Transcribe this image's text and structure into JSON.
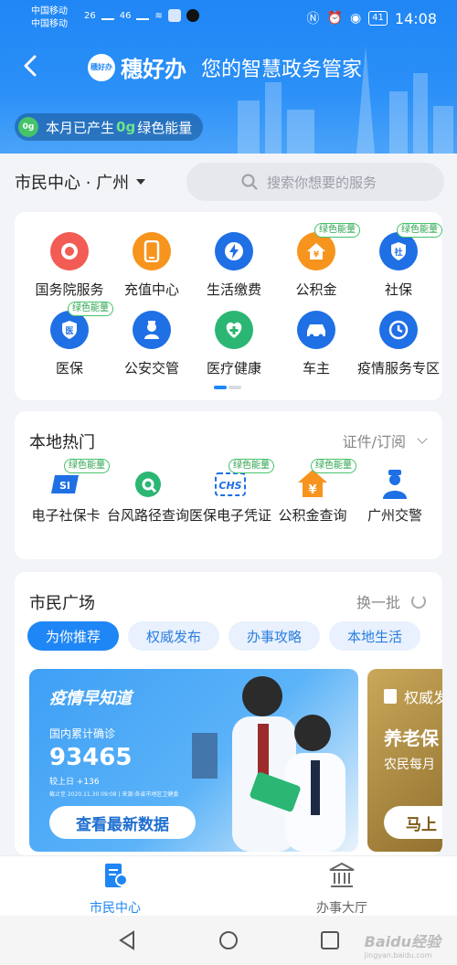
{
  "status_bar": {
    "carrier1": "中国移动",
    "carrier2": "中国移动",
    "signal1": "26",
    "signal2": "46",
    "battery": "41",
    "time": "14:08"
  },
  "header": {
    "logo_text": "穗好办",
    "app_name": "穗好办",
    "slogan": "您的智慧政务管家",
    "energy_badge": "0g",
    "energy_prefix": "本月已产生",
    "energy_value": "0g",
    "energy_suffix": "绿色能量"
  },
  "location": {
    "label": "市民中心 · 广州",
    "search_placeholder": "搜索你想要的服务"
  },
  "services": {
    "green_tag": "绿色能量",
    "items": [
      {
        "label": "国务院服务",
        "color": "#f25c54",
        "icon": "state-council-icon",
        "tag": false
      },
      {
        "label": "充值中心",
        "color": "#f7941d",
        "icon": "phone-icon",
        "tag": false
      },
      {
        "label": "生活缴费",
        "color": "#1f6fe5",
        "icon": "lightning-icon",
        "tag": false
      },
      {
        "label": "公积金",
        "color": "#f7941d",
        "icon": "house-yen-icon",
        "tag": true
      },
      {
        "label": "社保",
        "color": "#1f6fe5",
        "icon": "shield-icon",
        "tag": true
      },
      {
        "label": "医保",
        "color": "#1f6fe5",
        "icon": "medical-shield-icon",
        "tag": true
      },
      {
        "label": "公安交管",
        "color": "#1f6fe5",
        "icon": "police-icon",
        "tag": false
      },
      {
        "label": "医疗健康",
        "color": "#2bb673",
        "icon": "medical-icon",
        "tag": false
      },
      {
        "label": "车主",
        "color": "#1f6fe5",
        "icon": "car-icon",
        "tag": false
      },
      {
        "label": "疫情服务专区",
        "color": "#1f6fe5",
        "icon": "clock-icon",
        "tag": false
      }
    ]
  },
  "local_hot": {
    "title": "本地热门",
    "right_label": "证件/订阅",
    "green_tag": "绿色能量",
    "items": [
      {
        "label": "电子社保卡",
        "tag": true,
        "icon": "social-card-icon"
      },
      {
        "label": "台风路径查询",
        "tag": false,
        "icon": "typhoon-icon"
      },
      {
        "label": "医保电子凭证",
        "tag": true,
        "icon": "chs-icon"
      },
      {
        "label": "公积金查询",
        "tag": true,
        "icon": "fund-house-icon"
      },
      {
        "label": "广州交警",
        "tag": false,
        "icon": "traffic-police-icon"
      }
    ]
  },
  "plaza": {
    "title": "市民广场",
    "refresh_label": "换一批",
    "tabs": [
      "为你推荐",
      "权威发布",
      "办事攻略",
      "本地生活"
    ],
    "banner1": {
      "title": "疫情早知道",
      "subtitle": "国内累计确诊",
      "number": "93465",
      "increase": "较上日 +136",
      "note": "截止至 2020.11.30 09:08 | 来源:各省市地区卫健委",
      "button": "查看最新数据"
    },
    "banner2": {
      "tag": "权威发",
      "title": "养老保",
      "subtitle": "农民每月",
      "button": "马上"
    }
  },
  "bottom_nav": {
    "items": [
      {
        "label": "市民中心",
        "active": true
      },
      {
        "label": "办事大厅",
        "active": false
      }
    ]
  },
  "watermark": {
    "text": "Baidu经验",
    "sub": "jingyan.baidu.com"
  }
}
